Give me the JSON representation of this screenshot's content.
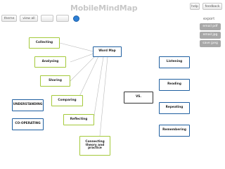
{
  "app": {
    "title": "MobileMindMap"
  },
  "toolbar": {
    "themes_label": "theme",
    "view_all_label": "view all",
    "zoom_label": "",
    "help_label": "help",
    "feedback_label": "feedback"
  },
  "export": {
    "label": "export",
    "buttons": [
      "email pdf",
      "email jpg",
      "save jpeg"
    ]
  },
  "colors": {
    "green_border": "#a4c93a",
    "blue_border": "#1f5fa0",
    "black_border": "#333333",
    "connector": "#b9b9b9"
  },
  "nodes": {
    "collecting": "Collecting",
    "analysing": "Analysing",
    "sharing": "Sharing",
    "comparing": "Comparing",
    "reflecting": "Reflecting",
    "connecting": "Connecting theory and practice",
    "word_map": "Word Map",
    "vs": "VS.",
    "listening": "Listening",
    "reading": "Reading",
    "repeating": "Repeating",
    "remembering": "Remembering",
    "understanding": "UNDERSTANDING",
    "cooperating": "CO-OPERATING"
  }
}
